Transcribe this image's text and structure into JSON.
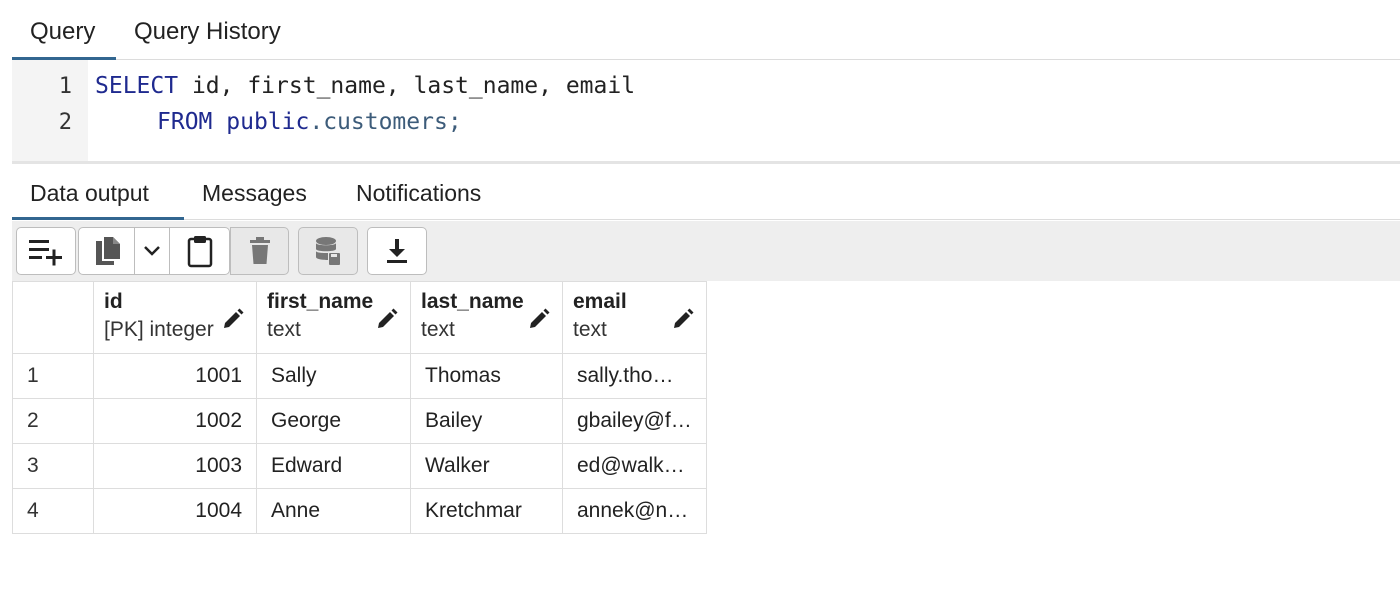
{
  "top_tabs": [
    {
      "label": "Query",
      "active": true
    },
    {
      "label": "Query History",
      "active": false
    }
  ],
  "editor": {
    "lines": [
      {
        "number": "1",
        "keyword": "SELECT",
        "rest": " id, first_name, last_name, email"
      },
      {
        "number": "2",
        "keyword": "FROM",
        "schema": "public",
        "table": ".customers;"
      }
    ]
  },
  "result_tabs": [
    {
      "label": "Data output",
      "active": true
    },
    {
      "label": "Messages",
      "active": false
    },
    {
      "label": "Notifications",
      "active": false
    }
  ],
  "toolbar": {
    "buttons": [
      {
        "icon": "add-row-icon"
      },
      {
        "icon": "copy-icon"
      },
      {
        "icon": "chevron-down-icon"
      },
      {
        "icon": "paste-icon"
      },
      {
        "icon": "delete-icon",
        "disabled": true
      },
      {
        "icon": "save-data-icon",
        "disabled": true
      },
      {
        "icon": "download-icon"
      }
    ]
  },
  "grid": {
    "columns": [
      {
        "name": "id",
        "type": "[PK] integer"
      },
      {
        "name": "first_name",
        "type": "text"
      },
      {
        "name": "last_name",
        "type": "text"
      },
      {
        "name": "email",
        "type": "text"
      }
    ],
    "rows": [
      {
        "n": "1",
        "id": "1001",
        "first_name": "Sally",
        "last_name": "Thomas",
        "email": "sally.tho…"
      },
      {
        "n": "2",
        "id": "1002",
        "first_name": "George",
        "last_name": "Bailey",
        "email": "gbailey@f…"
      },
      {
        "n": "3",
        "id": "1003",
        "first_name": "Edward",
        "last_name": "Walker",
        "email": "ed@walk…"
      },
      {
        "n": "4",
        "id": "1004",
        "first_name": "Anne",
        "last_name": "Kretchmar",
        "email": "annek@n…"
      }
    ]
  },
  "colors": {
    "accent": "#326690",
    "keyword": "#1f2a8f",
    "table_name": "#3d5c7a"
  }
}
